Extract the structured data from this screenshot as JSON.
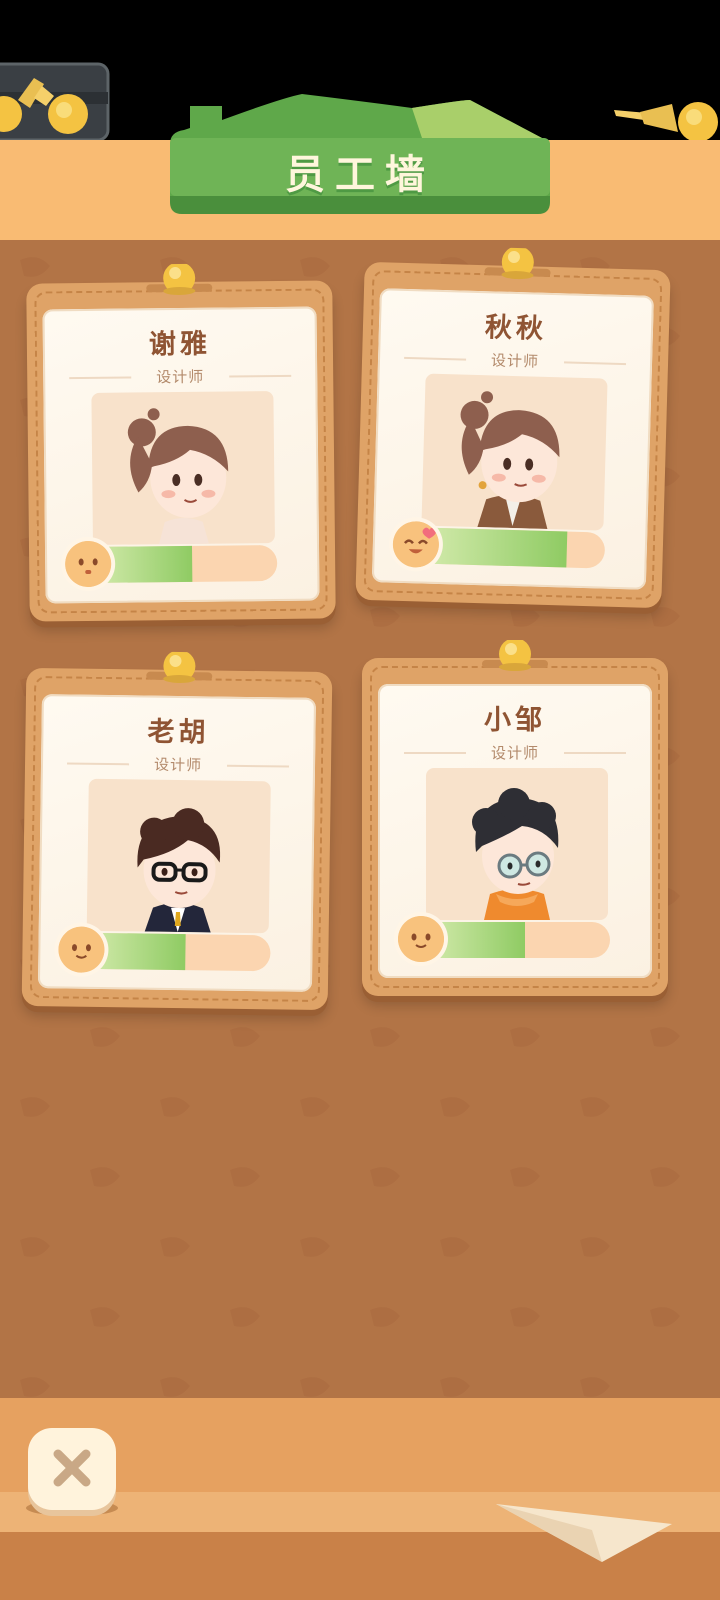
{
  "header": {
    "title": "员工墙"
  },
  "employees": [
    {
      "name": "谢雅",
      "role": "设计师",
      "mood_level": 0.55,
      "mood_icon": "neutral-face-icon"
    },
    {
      "name": "秋秋",
      "role": "设计师",
      "mood_level": 0.8,
      "mood_icon": "happy-heart-face-icon"
    },
    {
      "name": "老胡",
      "role": "设计师",
      "mood_level": 0.55,
      "mood_icon": "smile-face-icon"
    },
    {
      "name": "小邹",
      "role": "设计师",
      "mood_level": 0.55,
      "mood_icon": "smile-face-icon"
    }
  ],
  "footer": {
    "close_icon": "close-icon"
  },
  "colors": {
    "header_band": "#f9bb73",
    "title_banner": "#6fb456",
    "board": "#b27446",
    "card_frame": "#dfa367",
    "bar_fill": "#8fcb63",
    "bar_track": "#fbd5b0",
    "name_text": "#8f5433"
  }
}
